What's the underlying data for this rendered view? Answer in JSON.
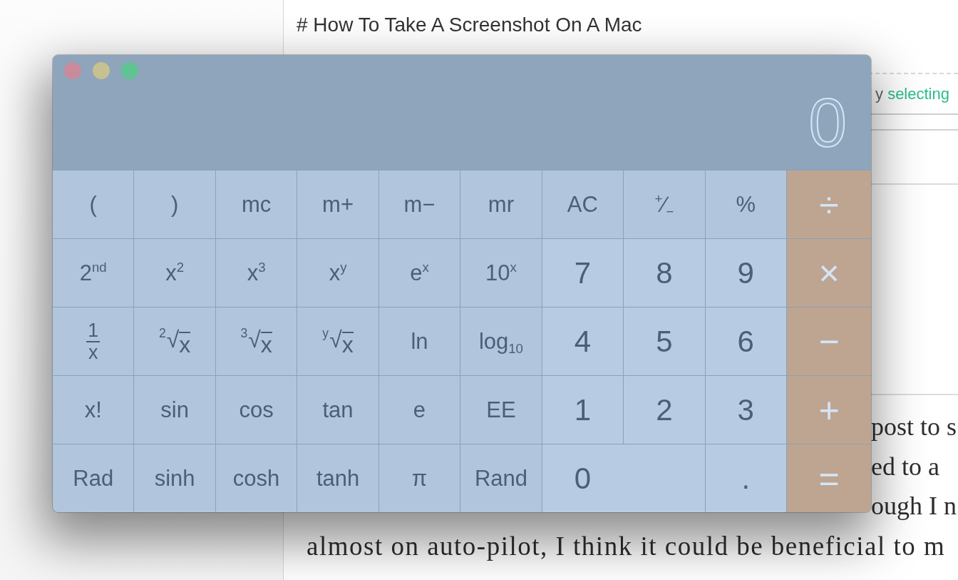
{
  "editor": {
    "heading": "# How To Take A Screenshot On A Mac",
    "preview": {
      "text": "y",
      "link": "selecting"
    },
    "body_lines": [
      {
        "kind": "partial",
        "text": "post to s"
      },
      {
        "kind": "partial",
        "text": "ed to a"
      },
      {
        "kind": "partial",
        "text": "ough I n"
      },
      {
        "kind": "full",
        "text": "almost on auto-pilot, I think it could be beneficial to m"
      }
    ]
  },
  "calculator": {
    "display": "0",
    "keypad": [
      {
        "keys": [
          {
            "kind": "function",
            "label": "("
          },
          {
            "kind": "function",
            "label": ")"
          },
          {
            "kind": "function",
            "label": "mc"
          },
          {
            "kind": "function",
            "label": "m+"
          },
          {
            "kind": "function",
            "label": "m−"
          },
          {
            "kind": "function",
            "label": "mr"
          },
          {
            "kind": "function",
            "label": "AC"
          },
          {
            "kind": "function",
            "label": "$^{+}$∕$_{−}$"
          },
          {
            "kind": "function",
            "label": "%"
          },
          {
            "kind": "operator",
            "label": "÷"
          }
        ]
      },
      {
        "keys": [
          {
            "kind": "function",
            "label": "2$^{nd}$"
          },
          {
            "kind": "function",
            "label": "x$^{2}$"
          },
          {
            "kind": "function",
            "label": "x$^{3}$"
          },
          {
            "kind": "function",
            "label": "x$^{y}$"
          },
          {
            "kind": "function",
            "label": "e$^{x}$"
          },
          {
            "kind": "function",
            "label": "10$^{x}$"
          },
          {
            "kind": "digit",
            "label": "7"
          },
          {
            "kind": "digit",
            "label": "8"
          },
          {
            "kind": "digit",
            "label": "9"
          },
          {
            "kind": "operator",
            "label": "×"
          }
        ]
      },
      {
        "keys": [
          {
            "kind": "fraction",
            "numerator": "1",
            "denominator": "x"
          },
          {
            "kind": "root",
            "index": "2",
            "sign": "√",
            "radicand": "x"
          },
          {
            "kind": "root",
            "index": "3",
            "sign": "√",
            "radicand": "x"
          },
          {
            "kind": "root",
            "index": "y",
            "sign": "√",
            "radicand": "x"
          },
          {
            "kind": "function",
            "label": "ln"
          },
          {
            "kind": "function",
            "label": "log$_{10}$"
          },
          {
            "kind": "digit",
            "label": "4"
          },
          {
            "kind": "digit",
            "label": "5"
          },
          {
            "kind": "digit",
            "label": "6"
          },
          {
            "kind": "operator",
            "label": "−"
          }
        ]
      },
      {
        "keys": [
          {
            "kind": "function",
            "label": "x!"
          },
          {
            "kind": "function",
            "label": "sin"
          },
          {
            "kind": "function",
            "label": "cos"
          },
          {
            "kind": "function",
            "label": "tan"
          },
          {
            "kind": "function",
            "label": "e"
          },
          {
            "kind": "function",
            "label": "EE"
          },
          {
            "kind": "digit",
            "label": "1"
          },
          {
            "kind": "digit",
            "label": "2"
          },
          {
            "kind": "digit",
            "label": "3"
          },
          {
            "kind": "operator",
            "label": "+"
          }
        ]
      },
      {
        "keys": [
          {
            "kind": "function",
            "label": "Rad"
          },
          {
            "kind": "function",
            "label": "sinh"
          },
          {
            "kind": "function",
            "label": "cosh"
          },
          {
            "kind": "function",
            "label": "tanh"
          },
          {
            "kind": "function",
            "label": "π"
          },
          {
            "kind": "function",
            "label": "Rand"
          },
          {
            "kind": "digit",
            "label": "0",
            "wide": true
          },
          {
            "kind": "digit",
            "label": "."
          },
          {
            "kind": "operator",
            "label": "="
          }
        ]
      }
    ]
  }
}
